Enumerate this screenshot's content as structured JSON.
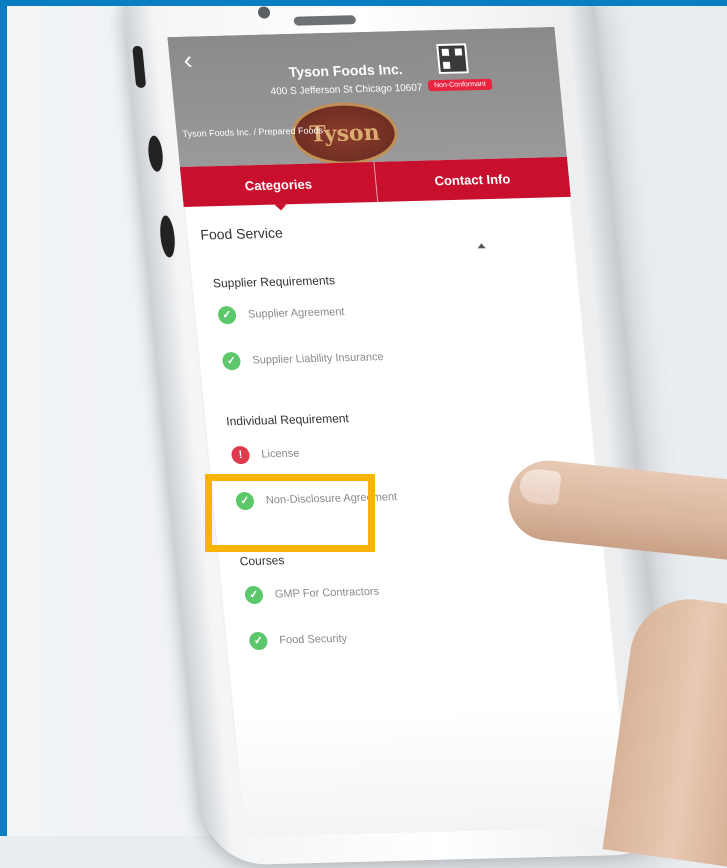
{
  "header": {
    "company_name": "Tyson Foods Inc.",
    "company_address": "400 S Jefferson St Chicago 10607",
    "company_path": "Tyson Foods Inc. / Prepared Foods",
    "logo_text": "Tyson",
    "status_badge": "Non-Conformant"
  },
  "tabs": [
    {
      "label": "Categories",
      "active": true
    },
    {
      "label": "Contact Info",
      "active": false
    }
  ],
  "section": {
    "title": "Food Service"
  },
  "groups": [
    {
      "title": "Supplier Requirements",
      "items": [
        {
          "label": "Supplier Agreement",
          "status": "ok"
        },
        {
          "label": "Supplier Liability Insurance",
          "status": "ok"
        }
      ]
    },
    {
      "title": "Individual Requirement",
      "items": [
        {
          "label": "License",
          "status": "bad"
        },
        {
          "label": "Non-Disclosure Agreement",
          "status": "ok"
        }
      ]
    },
    {
      "title": "Courses",
      "items": [
        {
          "label": "GMP For Contractors",
          "status": "ok"
        },
        {
          "label": "Food Security",
          "status": "ok"
        }
      ]
    }
  ],
  "icons": {
    "ok": "check-circle-icon",
    "bad": "alert-circle-icon"
  },
  "colors": {
    "accent_red": "#c8102e",
    "ok_green": "#5cc76b",
    "alert_red": "#e03a4f",
    "highlight": "#f8b400",
    "frame_blue": "#0a7ec2"
  }
}
